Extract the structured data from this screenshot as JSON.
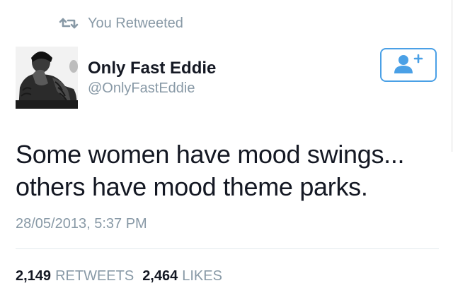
{
  "retweet_context": {
    "icon": "retweet-icon",
    "text": "You Retweeted"
  },
  "author": {
    "display_name": "Only Fast Eddie",
    "screen_name": "@OnlyFastEddie",
    "avatar_icon": "profile-photo"
  },
  "follow_button": {
    "icon": "add-user-icon"
  },
  "tweet": {
    "text_line_1": "Some women have mood swings...",
    "text_line_2": "others have mood theme parks.",
    "timestamp": "28/05/2013, 5:37 PM"
  },
  "stats": {
    "retweets_count": "2,149",
    "retweets_label": "RETWEETS",
    "likes_count": "2,464",
    "likes_label": "LIKES"
  },
  "colors": {
    "accent": "#4aa0e6",
    "muted_text": "#8899a6",
    "primary_text": "#141823",
    "divider": "#e1e8ed"
  }
}
